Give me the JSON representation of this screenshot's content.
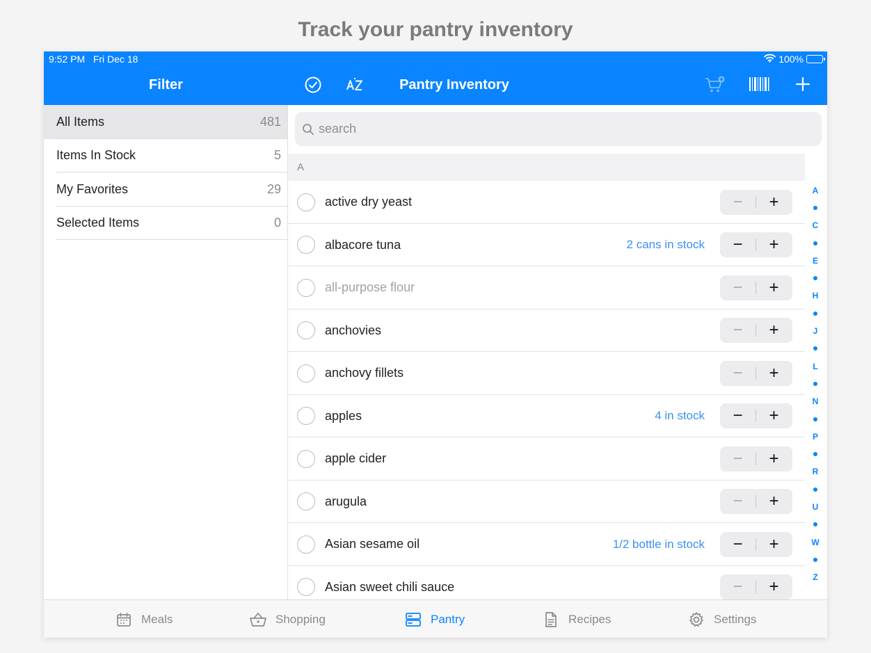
{
  "promo": {
    "headline": "Track your pantry inventory"
  },
  "status": {
    "time": "9:52 PM",
    "date": "Fri Dec 18",
    "battery": "100%"
  },
  "header": {
    "filter_title": "Filter",
    "title": "Pantry Inventory"
  },
  "filters": [
    {
      "label": "All Items",
      "count": "481",
      "selected": true
    },
    {
      "label": "Items In Stock",
      "count": "5",
      "selected": false
    },
    {
      "label": "My Favorites",
      "count": "29",
      "selected": false
    },
    {
      "label": "Selected Items",
      "count": "0",
      "selected": false
    }
  ],
  "search": {
    "placeholder": "search"
  },
  "section": {
    "letter": "A"
  },
  "items": [
    {
      "name": "active dry yeast",
      "stock": "",
      "muted": false
    },
    {
      "name": "albacore tuna",
      "stock": "2 cans in stock",
      "muted": false
    },
    {
      "name": "all-purpose flour",
      "stock": "",
      "muted": true
    },
    {
      "name": "anchovies",
      "stock": "",
      "muted": false
    },
    {
      "name": "anchovy fillets",
      "stock": "",
      "muted": false
    },
    {
      "name": "apples",
      "stock": "4 in stock",
      "muted": false
    },
    {
      "name": "apple cider",
      "stock": "",
      "muted": false
    },
    {
      "name": "arugula",
      "stock": "",
      "muted": false
    },
    {
      "name": "Asian sesame oil",
      "stock": "1/2 bottle in stock",
      "muted": false
    },
    {
      "name": "Asian sweet chili sauce",
      "stock": "",
      "muted": false
    }
  ],
  "index": [
    "A",
    "•",
    "C",
    "•",
    "E",
    "•",
    "H",
    "•",
    "J",
    "•",
    "L",
    "•",
    "N",
    "•",
    "P",
    "•",
    "R",
    "•",
    "U",
    "•",
    "W",
    "•",
    "Z"
  ],
  "tabs": [
    {
      "label": "Meals",
      "icon": "calendar-icon",
      "active": false
    },
    {
      "label": "Shopping",
      "icon": "basket-icon",
      "active": false
    },
    {
      "label": "Pantry",
      "icon": "pantry-icon",
      "active": true
    },
    {
      "label": "Recipes",
      "icon": "document-icon",
      "active": false
    },
    {
      "label": "Settings",
      "icon": "gear-icon",
      "active": false
    }
  ],
  "colors": {
    "accent": "#0a84ff",
    "stock_text": "#3b8ff5",
    "promo_text": "#7b7b7b"
  }
}
